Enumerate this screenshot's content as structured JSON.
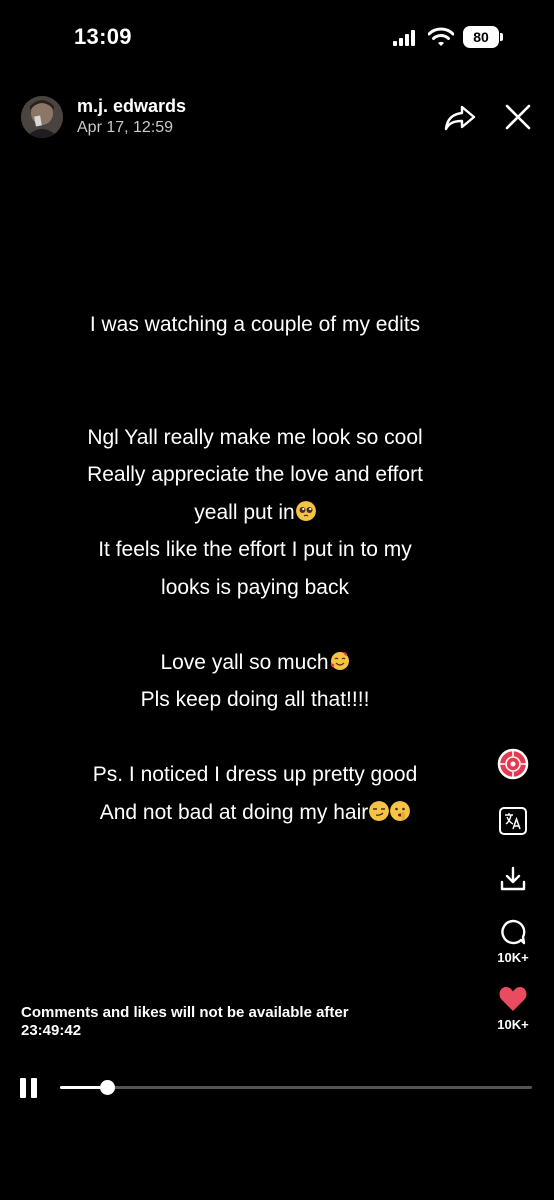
{
  "status_bar": {
    "time": "13:09",
    "battery": "80"
  },
  "header": {
    "username": "m.j. edwards",
    "date": "Apr 17, 12:59"
  },
  "post": {
    "lines": [
      "I was watching a couple of my edits",
      "",
      "",
      "Ngl Yall really make me look so cool",
      "Really appreciate the love and effort",
      "yeall put in",
      "It feels like the effort I put in to my",
      "looks is paying back",
      "",
      "Love yall so much",
      "Pls keep doing all that!!!!",
      "",
      "Ps. I noticed I dress up pretty good",
      "And not bad at doing my hair"
    ]
  },
  "rail": {
    "comments_count": "10K+",
    "likes_count": "10K+",
    "like_color": "#e94b5f"
  },
  "footer": {
    "notice": "Comments and likes will not be available after 23:49:42",
    "progress": 0.1
  }
}
